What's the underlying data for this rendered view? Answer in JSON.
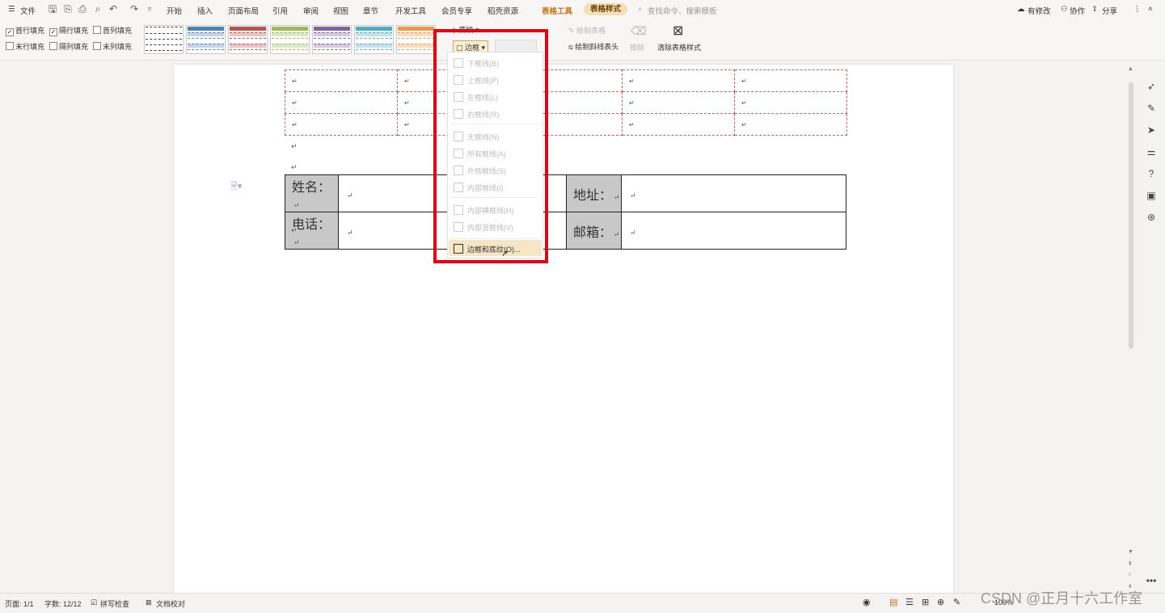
{
  "menu": {
    "file": "文件",
    "tabs": [
      "开始",
      "插入",
      "页面布局",
      "引用",
      "审阅",
      "视图",
      "章节",
      "开发工具",
      "会员专享",
      "稻壳资源"
    ],
    "table_tools": "表格工具",
    "table_style": "表格样式",
    "search_placeholder": "查找命令、搜索模板",
    "has_changes": "有修改",
    "collab": "协作",
    "share": "分享"
  },
  "ribbon": {
    "options": [
      {
        "label": "首行填充",
        "checked": true
      },
      {
        "label": "隔行填充",
        "checked": true
      },
      {
        "label": "首列填充",
        "checked": false
      },
      {
        "label": "末行填充",
        "checked": false
      },
      {
        "label": "隔列填充",
        "checked": false
      },
      {
        "label": "末列填充",
        "checked": false
      }
    ],
    "style_colors": [
      "#ffffff",
      "#4f81bd",
      "#c0504d",
      "#9bbb59",
      "#8064a2",
      "#4bacc6",
      "#f79646"
    ],
    "shading_label": "底纹",
    "border_label": "边框",
    "draw_table": "绘制表格",
    "draw_diagonal": "绘制斜线表头",
    "erase": "擦除",
    "clear_style": "清除表格样式"
  },
  "dropdown": {
    "items": [
      {
        "label": "下框线(B)",
        "enabled": false
      },
      {
        "label": "上框线(P)",
        "enabled": false
      },
      {
        "label": "左框线(L)",
        "enabled": false
      },
      {
        "label": "右框线(R)",
        "enabled": false
      },
      {
        "label": "无框线(N)",
        "enabled": false
      },
      {
        "label": "所有框线(A)",
        "enabled": false
      },
      {
        "label": "外侧框线(S)",
        "enabled": false
      },
      {
        "label": "内部框线(I)",
        "enabled": false
      },
      {
        "label": "内部横框线(H)",
        "enabled": false
      },
      {
        "label": "内部竖框线(V)",
        "enabled": false
      },
      {
        "label": "边框和底纹(O)...",
        "enabled": true
      }
    ]
  },
  "document": {
    "return_mark": "↵",
    "form": {
      "name_label": "姓名：",
      "address_label": "地址：",
      "phone_label": "电话：",
      "email_label": "邮箱："
    }
  },
  "status": {
    "page": "页面: 1/1",
    "words": "字数: 12/12",
    "spell_check": "拼写检查",
    "doc_proof": "文档校对",
    "zoom": "100%"
  },
  "watermark": "CSDN @正月十六工作室"
}
